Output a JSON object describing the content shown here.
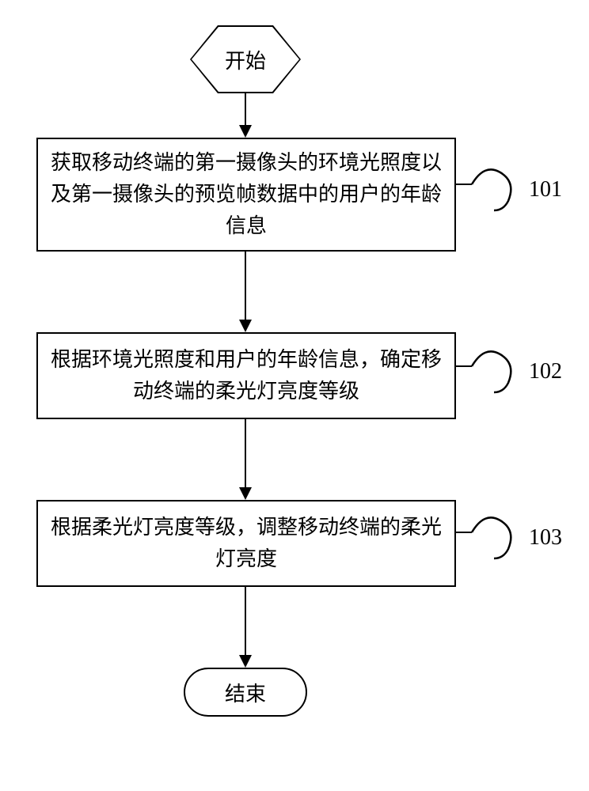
{
  "flow": {
    "start": "开始",
    "end": "结束",
    "steps": [
      {
        "text": "获取移动终端的第一摄像头的环境光照度以及第一摄像头的预览帧数据中的用户的年龄信息",
        "label": "101"
      },
      {
        "text": "根据环境光照度和用户的年龄信息，确定移动终端的柔光灯亮度等级",
        "label": "102"
      },
      {
        "text": "根据柔光灯亮度等级，调整移动终端的柔光灯亮度",
        "label": "103"
      }
    ]
  }
}
